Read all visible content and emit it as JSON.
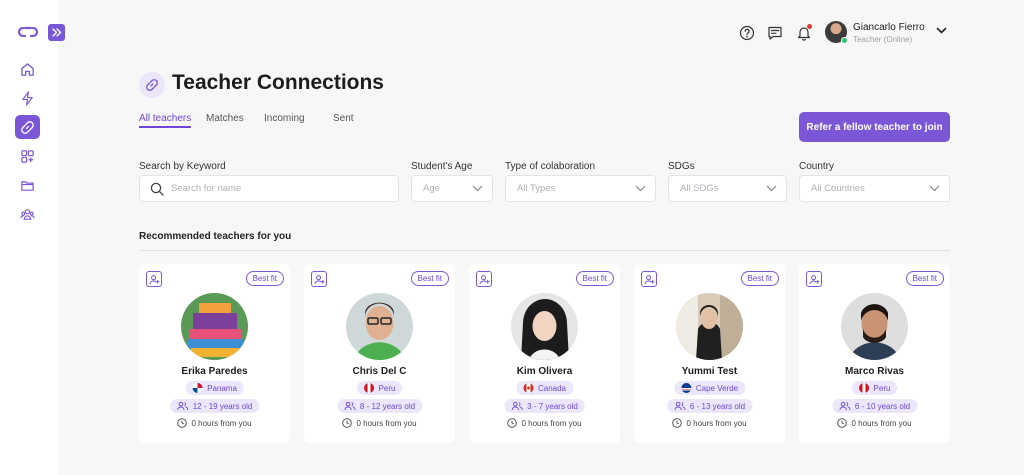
{
  "header": {
    "user_name": "Giancarlo Fierro",
    "user_status": "Teacher (Online)"
  },
  "page": {
    "title": "Teacher Connections",
    "tabs": [
      {
        "label": "All teachers",
        "active": true
      },
      {
        "label": "Matches",
        "active": false
      },
      {
        "label": "Incoming",
        "active": false
      },
      {
        "label": "Sent",
        "active": false
      }
    ],
    "refer_button": "Refer a fellow teacher to join"
  },
  "filters": {
    "keyword_label": "Search by Keyword",
    "keyword_placeholder": "Search for name",
    "age_label": "Student's Age",
    "age_value": "Age",
    "collab_label": "Type of colaboration",
    "collab_value": "All Types",
    "sdg_label": "SDGs",
    "sdg_value": "All SDGs",
    "country_label": "Country",
    "country_value": "All Countries"
  },
  "section": {
    "title": "Recommended teachers for you"
  },
  "cards": [
    {
      "name": "Erika Paredes",
      "country": "Panama",
      "ages": "12 - 19 years old",
      "hours": "0 hours from you",
      "badge": "Best fit"
    },
    {
      "name": "Chris Del C",
      "country": "Peru",
      "ages": "8 - 12 years old",
      "hours": "0 hours from you",
      "badge": "Best fit"
    },
    {
      "name": "Kim Olivera",
      "country": "Canada",
      "ages": "3 - 7 years old",
      "hours": "0 hours from you",
      "badge": "Best fit"
    },
    {
      "name": "Yummi Test",
      "country": "Cape Verde",
      "ages": "6 - 13 years old",
      "hours": "0 hours from you",
      "badge": "Best fit"
    },
    {
      "name": "Marco Rivas",
      "country": "Peru",
      "ages": "6 - 10 years old",
      "hours": "0 hours from you",
      "badge": "Best fit"
    }
  ],
  "colors": {
    "accent": "#7b57d8",
    "accent_soft": "#ece6fb",
    "online": "#27c26c",
    "notification": "#e53935"
  },
  "icons": {
    "nav": [
      "home-icon",
      "lightning-icon",
      "link-icon",
      "apps-add-icon",
      "folder-icon",
      "users-icon"
    ],
    "header": [
      "help-icon",
      "chat-icon",
      "bell-icon"
    ]
  }
}
